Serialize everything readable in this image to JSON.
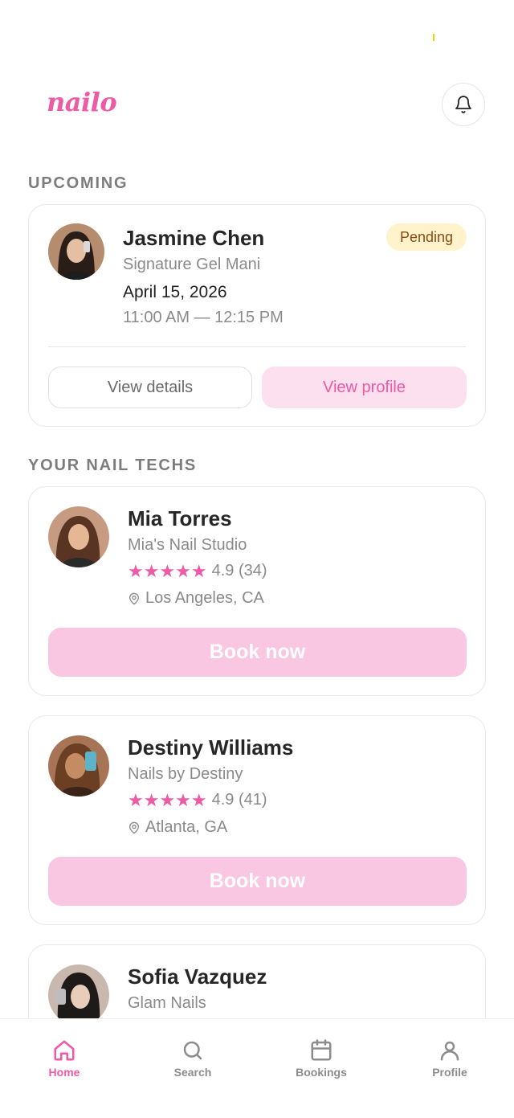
{
  "app": {
    "logo": "nailo"
  },
  "upcoming": {
    "title": "UPCOMING",
    "appointment": {
      "client_name": "Jasmine Chen",
      "service": "Signature Gel Mani",
      "date": "April 15, 2026",
      "time": "11:00 AM — 12:15 PM",
      "status": "Pending",
      "actions": {
        "details": "View details",
        "profile": "View profile"
      }
    }
  },
  "techs": {
    "title": "YOUR NAIL TECHS",
    "items": [
      {
        "name": "Mia Torres",
        "salon": "Mia's Nail Studio",
        "stars": "★★★★★",
        "rating": "4.9 (34)",
        "location": "Los Angeles, CA",
        "cta": "Book now"
      },
      {
        "name": "Destiny Williams",
        "salon": "Nails by Destiny",
        "stars": "★★★★★",
        "rating": "4.9 (41)",
        "location": "Atlanta, GA",
        "cta": "Book now"
      },
      {
        "name": "Sofia Vazquez",
        "salon": "Glam Nails"
      }
    ]
  },
  "tabs": [
    {
      "label": "Home",
      "icon": "home-icon",
      "active": true
    },
    {
      "label": "Search",
      "icon": "search-icon"
    },
    {
      "label": "Bookings",
      "icon": "calendar-icon"
    },
    {
      "label": "Profile",
      "icon": "user-icon"
    }
  ],
  "colors": {
    "brand": "#ee5aa5",
    "badge_bg": "#fff3cc",
    "book_button": "#f9c7e1",
    "soft_pink": "#fde0ef"
  }
}
